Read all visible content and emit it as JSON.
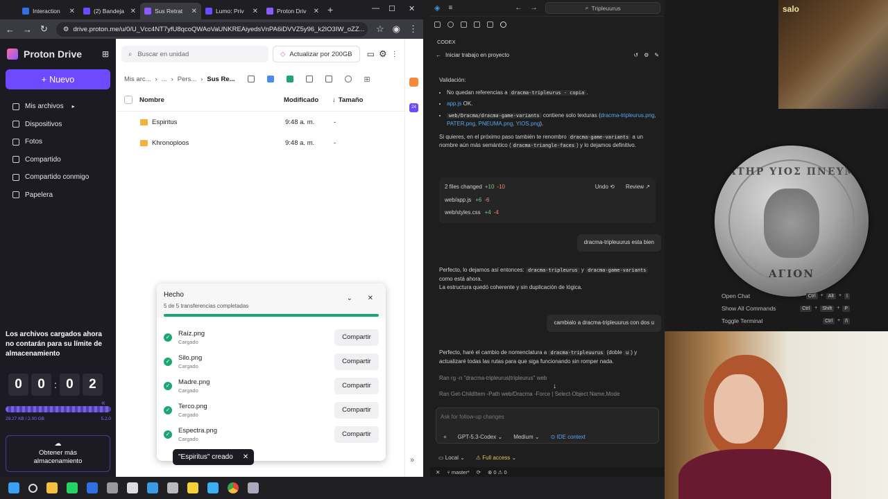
{
  "browser": {
    "tabs": [
      {
        "label": "Interaction",
        "color": "#2f6fe0",
        "active": false
      },
      {
        "label": "(2) Bandeja",
        "color": "#6d4aff",
        "active": false
      },
      {
        "label": "Sus Retrat",
        "color": "#8a5bff",
        "active": true
      },
      {
        "label": "Lumo: Priv",
        "color": "#6d4aff",
        "active": false
      },
      {
        "label": "Proton Driv",
        "color": "#8a5bff",
        "active": false
      }
    ],
    "url": "drive.proton.me/u/0/U_Vcc4NT7yfU8qcoQWAoVaUNKREAiyedsVnPA6iDVVZ5y96_k2IO3IW_oZZ..."
  },
  "proton": {
    "brand": "Proton Drive",
    "new_button": "Nuevo",
    "nav": [
      {
        "label": "Mis archivos",
        "icon": "folder-icon"
      },
      {
        "label": "Dispositivos",
        "icon": "devices-icon"
      },
      {
        "label": "Fotos",
        "icon": "photos-icon"
      },
      {
        "label": "Compartido",
        "icon": "shared-icon"
      },
      {
        "label": "Compartido conmigo",
        "icon": "shared-with-me-icon"
      },
      {
        "label": "Papelera",
        "icon": "trash-icon"
      }
    ],
    "promo": "Los archivos cargados ahora no contarán para su límite de almacenamiento",
    "timer": [
      "0",
      "0",
      "0",
      "2"
    ],
    "storage_used": "29.27 KB / 2.00 GB",
    "version": "5.2.0",
    "get_more": "Obtener más almacenamiento",
    "search_placeholder": "Buscar en unidad",
    "upgrade": "Actualizar por 200GB",
    "breadcrumb": [
      "Mis arc...",
      "...",
      "Pers...",
      "Sus Re..."
    ],
    "columns": {
      "name": "Nombre",
      "modified": "Modificado",
      "size": "Tamaño"
    },
    "files": [
      {
        "name": "Espiritus",
        "modified": "9:48 a. m.",
        "size": "-"
      },
      {
        "name": "Khronoploos",
        "modified": "9:48 a. m.",
        "size": "-"
      }
    ],
    "transfers": {
      "title": "Hecho",
      "subtitle": "5 de 5 transferencias completadas",
      "progress": 1.0,
      "items": [
        {
          "name": "Raíz.png",
          "state": "Cargado",
          "action": "Compartir"
        },
        {
          "name": "Silo.png",
          "state": "Cargado",
          "action": "Compartir"
        },
        {
          "name": "Madre.png",
          "state": "Cargado",
          "action": "Compartir"
        },
        {
          "name": "Terco.png",
          "state": "Cargado",
          "action": "Compartir"
        },
        {
          "name": "Espectra.png",
          "state": "Cargado",
          "action": "Compartir"
        }
      ]
    },
    "toast": "\"Espiritus\" creado"
  },
  "vscode": {
    "search": "Tripleuurus",
    "panel": "CODEX",
    "task": "Iniciar trabajo en proyecto",
    "validation_heading": "Validación:",
    "bullets": {
      "b1_prefix": "No quedan referencias a",
      "b1_code": "dracma-tripleurus - copia",
      "b2_link": "app.js",
      "b2_text": "OK.",
      "b3_code": "web/Dracma/dracma-game-variants",
      "b3_text": "contiene solo texturas (",
      "b3_links": "dracma-tripleurus.png, PATER.png, PNEUMA.png, YIOS.png",
      "b3_end": ")."
    },
    "suggest_text_1": "Si quieres, en el próximo paso también te renombro",
    "suggest_code_1": "dracma-game-variants",
    "suggest_text_2": "a un nombre aún más semántico (",
    "suggest_code_2": "dracma-triangle-faces",
    "suggest_text_3": ") y lo dejamos definitivo.",
    "changes": {
      "summary": "2 files changed",
      "add": "+10",
      "del": "-10",
      "undo": "Undo",
      "review": "Review",
      "files": [
        {
          "name": "web/app.js",
          "add": "+6",
          "del": "-6"
        },
        {
          "name": "web/styles.css",
          "add": "+4",
          "del": "-4"
        }
      ]
    },
    "user_msg_1": "dracma-tripleuurus esta bien",
    "reply1_a": "Perfecto, lo dejamos así entonces:",
    "reply1_code1": "dracma-tripleurus",
    "reply1_y": "y",
    "reply1_code2": "dracma-game-variants",
    "reply1_b": "como está ahora.",
    "reply1_c": "La estructura quedó coherente y sin duplicación de lógica.",
    "user_msg_2": "cambialo a dracma-tripleuurus con dos u",
    "reply2_a": "Perfecto, haré el cambio de nomenclatura a",
    "reply2_code": "dracma-tripleuurus",
    "reply2_b": "(doble",
    "reply2_u": "u",
    "reply2_c": ") y actualizaré todas las rutas para que siga funcionando sin romper nada.",
    "ran_1": "Ran rg -n \"dracma-tripleurus|tripleurus\" web",
    "ran_2": "Ran Get-ChildItem -Path web/Dracma -Force | Select-Object Name,Mode",
    "input_placeholder": "Ask for follow-up changes",
    "model": "GPT-5.3-Codex",
    "effort": "Medium",
    "ide_context": "IDE context",
    "env": "Local",
    "access": "Full access",
    "branch": "master*",
    "problems": "0",
    "warnings": "0"
  },
  "overlay": {
    "thumb_label": "salo",
    "coin_top": "ΠΑΤΗΡ ΥΙΟΣ ΠΝΕΥΜΑ",
    "coin_bottom": "ΑΓΙΟΝ",
    "commands": [
      {
        "label": "Open Chat",
        "keys": [
          "Ctrl",
          "+",
          "Alt",
          "+",
          "I"
        ]
      },
      {
        "label": "Show All Commands",
        "keys": [
          "Ctrl",
          "+",
          "Shift",
          "+",
          "P"
        ]
      },
      {
        "label": "Toggle Terminal",
        "keys": [
          "Ctrl",
          "+",
          "ñ"
        ]
      }
    ]
  },
  "taskbar": {
    "icons": [
      "windows-start-icon",
      "search-icon",
      "file-explorer-icon",
      "whatsapp-icon",
      "store-icon",
      "files-icon",
      "chatgpt-icon",
      "vscode-icon",
      "settings-gear-icon",
      "notes-icon",
      "notepad-icon",
      "chrome-icon",
      "gear-app-icon"
    ]
  }
}
